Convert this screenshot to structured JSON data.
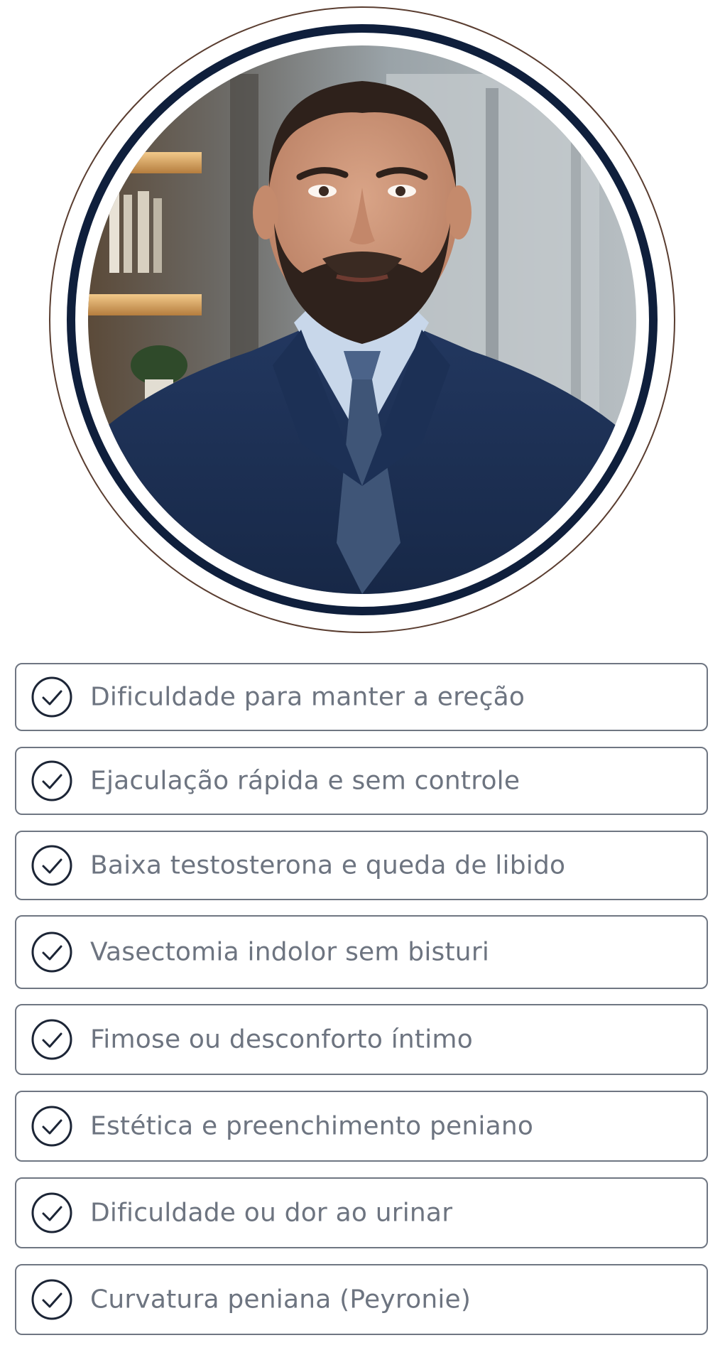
{
  "portrait": {
    "icon": "doctor-portrait-photo"
  },
  "checklist": {
    "icon": "check-circle-icon",
    "items": [
      {
        "label": "Dificuldade para manter a ereção"
      },
      {
        "label": "Ejaculação rápida e sem controle"
      },
      {
        "label": "Baixa testosterona e queda de libido"
      },
      {
        "label": "Vasectomia indolor sem bisturi"
      },
      {
        "label": "Fimose ou desconforto íntimo"
      },
      {
        "label": "Estética e preenchimento peniano"
      },
      {
        "label": "Dificuldade ou dor ao urinar"
      },
      {
        "label": "Curvatura peniana (Peyronie)"
      }
    ]
  },
  "colors": {
    "navy_ring": "#0f1f3c",
    "outer_ring": "#5a3d30",
    "text": "#6d7480",
    "border": "#6f7682",
    "check": "#1c2536"
  }
}
